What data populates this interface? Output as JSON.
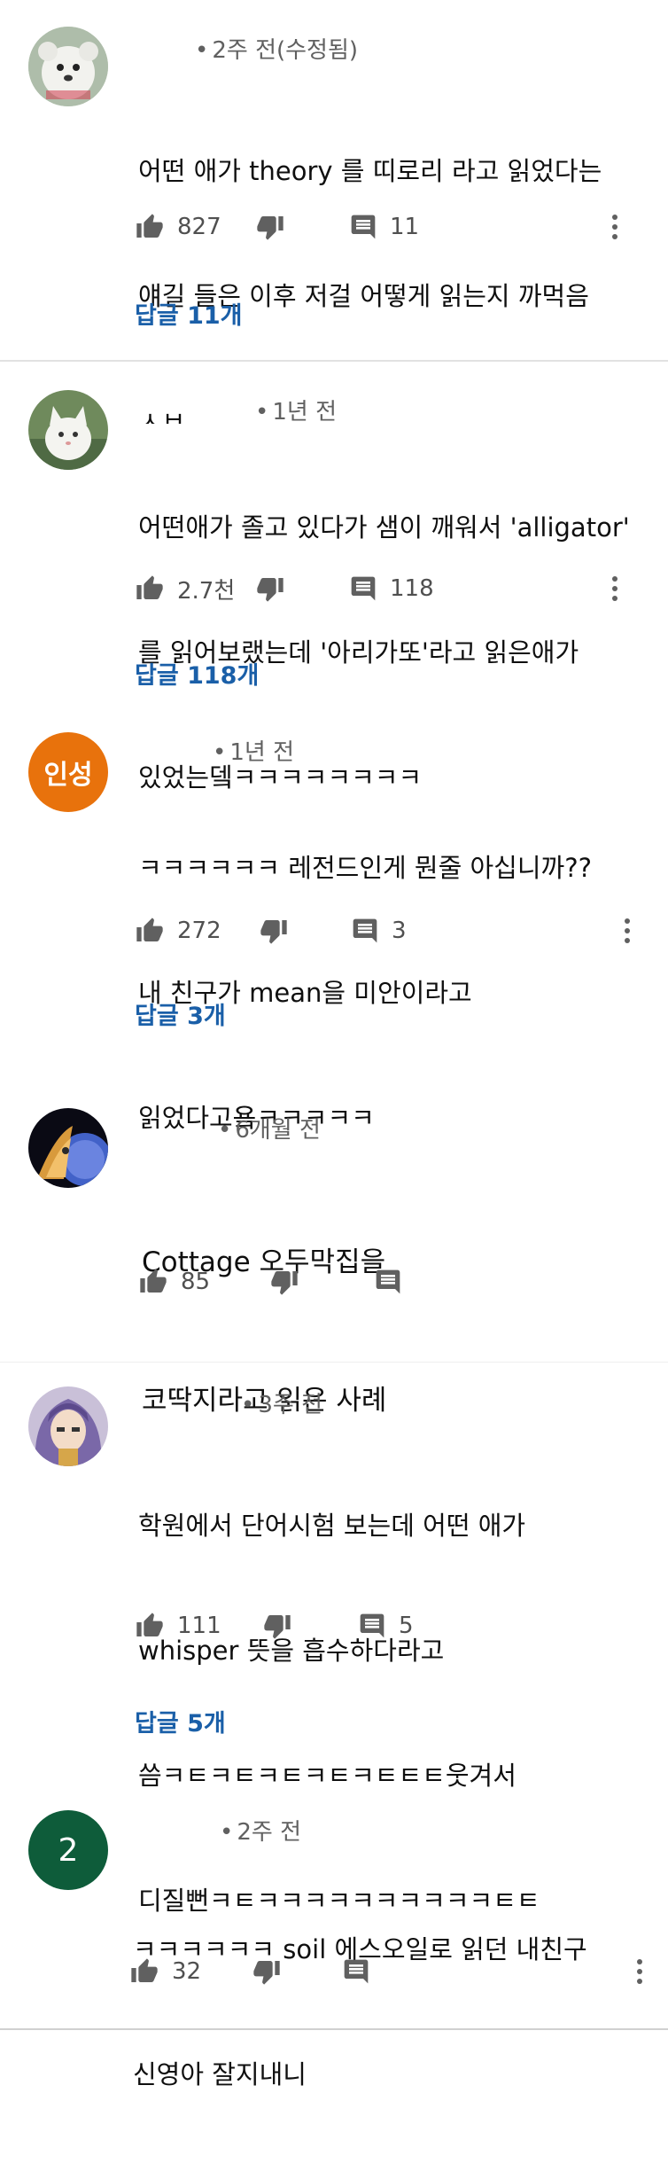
{
  "comments": [
    {
      "meta": "2주 전(수정됨)",
      "lines": [
        "어떤 애가 theory 를 띠로리 라고 읽었다는",
        "얘길 들은 이후 저걸 어떻게 읽는지 까먹음",
        "ㅅㅂ"
      ],
      "likes": "827",
      "reply_count": "11",
      "replies_label": "답글 11개",
      "avatar_icon": "plush-toy-avatar-icon"
    },
    {
      "meta": "1년 전",
      "lines": [
        "어떤애가 졸고 있다가 샘이 깨워서 'alligator'",
        "를 읽어보랬는데 '아리가또'라고 읽은애가",
        "있었는뎈ㅋㅋㅋㅋㅋㅋㅋㅋ"
      ],
      "likes": "2.7천",
      "reply_count": "118",
      "replies_label": "답글 118개",
      "avatar_icon": "white-cat-avatar-icon"
    },
    {
      "meta": "1년 전",
      "lines": [
        "ㅋㅋㅋㅋㅋㅋ 레전드인게 뭔줄 아십니까??",
        "내 친구가 mean을 미안이라고",
        "읽었다고욬ㅋㅋㅋㅋㅋ"
      ],
      "likes": "272",
      "reply_count": "3",
      "replies_label": "답글 3개",
      "avatar_text": "인성",
      "avatar_color": "#e8720c"
    },
    {
      "meta": "6개월 전",
      "lines": [
        "Cottage 오두막집을",
        "코딱지라고 읽은 사례"
      ],
      "likes": "85",
      "avatar_icon": "anime-character-avatar-icon"
    },
    {
      "meta": "3주 전",
      "lines": [
        "학원에서 단어시험 보는데 어떤 애가",
        "whisper 뜻을 흡수하다라고",
        "씀ㅋㅌㅋㅌㅋㅌㅋㅌㅋㅌㅌㅌ웃겨서",
        "디질뻔ㅋㅌㅋㅋㅋㅋㅋㅋㅋㅋㅋㅋㅌㅌ"
      ],
      "likes": "111",
      "reply_count": "5",
      "replies_label": "답글 5개",
      "avatar_icon": "purple-hair-character-avatar-icon"
    },
    {
      "meta": "2주 전",
      "lines": [
        "ㅋㅋㅋㅋㅋㅋ soil 에스오일로 읽던 내친구",
        "신영아 잘지내니"
      ],
      "likes": "32",
      "avatar_text": "2",
      "avatar_color": "#0e5c3a"
    }
  ],
  "colors": {
    "link": "#1a5fa8",
    "meta": "#606060",
    "icon": "#606060"
  }
}
